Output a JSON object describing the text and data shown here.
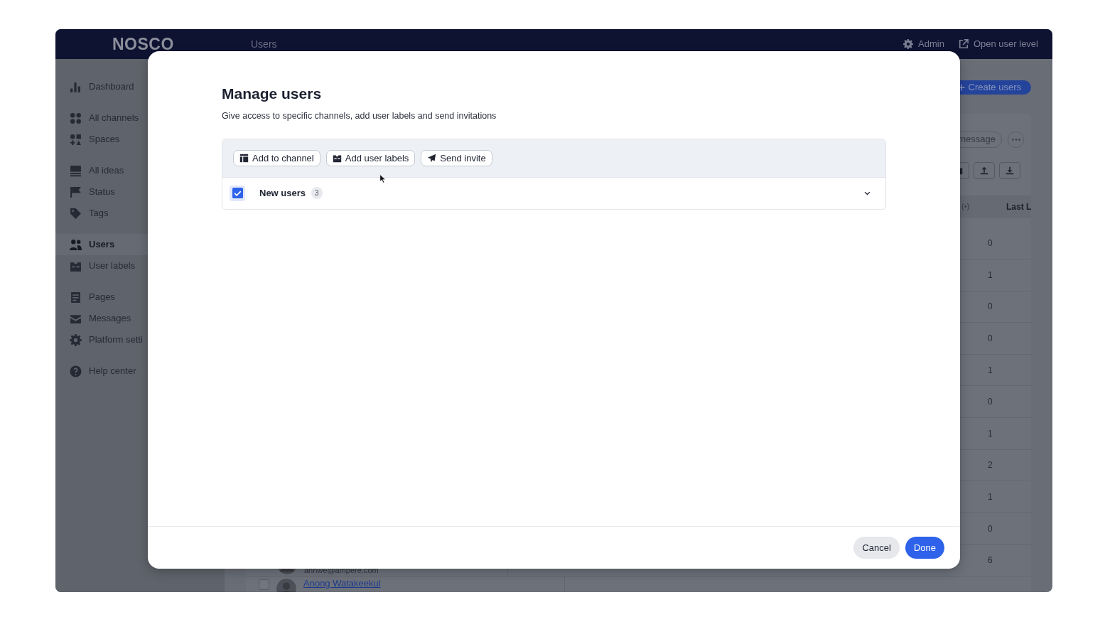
{
  "app": {
    "logo": "NOSCO",
    "page_title": "Users",
    "header_links": [
      {
        "label": "Admin",
        "kind": "gear"
      },
      {
        "label": "Open user level",
        "kind": "external"
      }
    ]
  },
  "sidebar": {
    "groups": [
      [
        {
          "label": "Dashboard",
          "kind": "bars",
          "selected": false
        }
      ],
      [
        {
          "label": "All channels",
          "kind": "grid",
          "selected": false
        },
        {
          "label": "Spaces",
          "kind": "spaces",
          "selected": false
        }
      ],
      [
        {
          "label": "All ideas",
          "kind": "list",
          "selected": false
        },
        {
          "label": "Status",
          "kind": "flag",
          "selected": false
        },
        {
          "label": "Tags",
          "kind": "tag",
          "selected": false
        }
      ],
      [
        {
          "label": "Users",
          "kind": "users",
          "selected": true
        },
        {
          "label": "User labels",
          "kind": "labels",
          "selected": false
        }
      ],
      [
        {
          "label": "Pages",
          "kind": "page",
          "selected": false
        },
        {
          "label": "Messages",
          "kind": "mail",
          "selected": false
        },
        {
          "label": "Platform setti",
          "kind": "gear",
          "selected": false
        }
      ],
      [
        {
          "label": "Help center",
          "kind": "help",
          "selected": false
        }
      ]
    ]
  },
  "content": {
    "create_button": "Create users",
    "toolbar_button": "message",
    "columns": [
      "(•)",
      "Last L"
    ],
    "rows": [
      {
        "count": "0"
      },
      {
        "count": "1"
      },
      {
        "count": "0"
      },
      {
        "count": "0"
      },
      {
        "count": "1"
      },
      {
        "count": "0"
      },
      {
        "count": "1"
      },
      {
        "count": "2"
      },
      {
        "count": "1"
      },
      {
        "count": "0"
      },
      {
        "count": "6",
        "email": "annwe@ampere.com"
      },
      {
        "name": "Anong Watakeekul",
        "checked": false
      }
    ]
  },
  "modal": {
    "title": "Manage users",
    "subtitle": "Give access to specific channels, add user labels and send invitations",
    "actions": [
      {
        "label": "Add to channel",
        "kind": "channel"
      },
      {
        "label": "Add user labels",
        "kind": "labels"
      },
      {
        "label": "Send invite",
        "kind": "send"
      }
    ],
    "group": {
      "label": "New users",
      "count": "3",
      "checked": true,
      "expanded": false
    },
    "buttons": [
      {
        "label": "Cancel",
        "kind": "secondary"
      },
      {
        "label": "Done",
        "kind": "primary"
      }
    ]
  }
}
